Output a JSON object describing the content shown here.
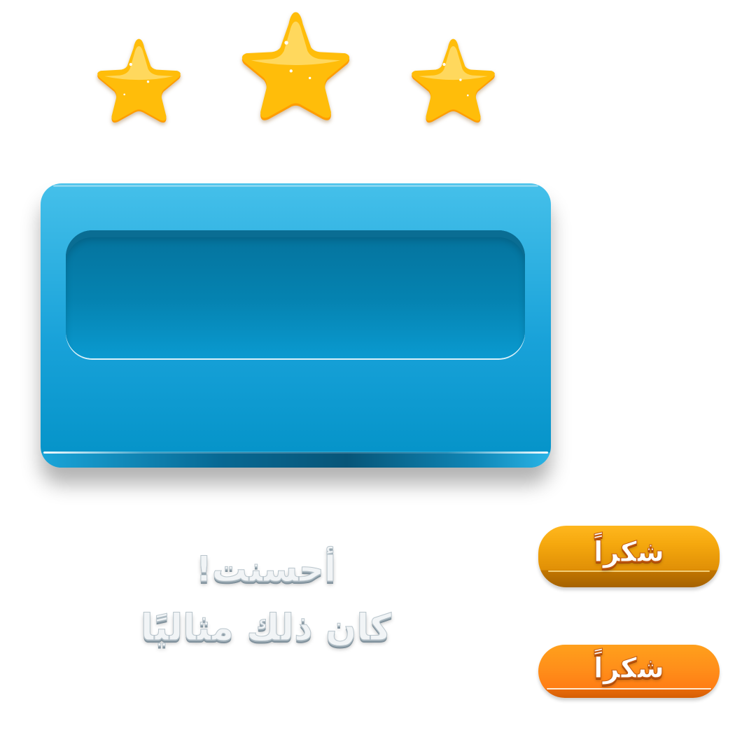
{
  "rating": {
    "stars_earned": 3,
    "stars_total": 3,
    "star_icon": "star-icon",
    "star_color": "#ffb300"
  },
  "panel": {
    "color": "#1aa3d9",
    "inner_color": "#0583b1"
  },
  "praise": {
    "line1": "أحسنت!",
    "line2": "كان ذلك مثاليًا"
  },
  "buttons": [
    {
      "label": "شكراً",
      "color": "#f0a00c"
    },
    {
      "label": "شكراً",
      "color": "#ff8c18"
    }
  ]
}
